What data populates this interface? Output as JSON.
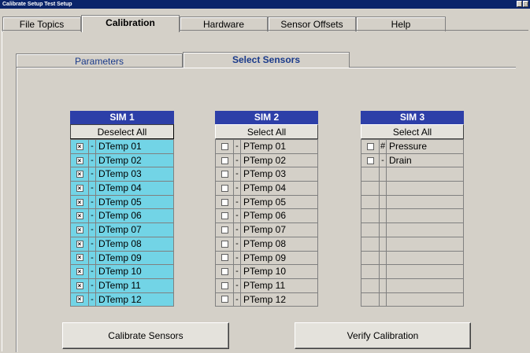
{
  "window": {
    "title": "Calibrate Setup Test Setup",
    "controls": [
      "_",
      "□"
    ]
  },
  "main_tabs": [
    {
      "label": "File Topics"
    },
    {
      "label": "Calibration"
    },
    {
      "label": "Hardware"
    },
    {
      "label": "Sensor Offsets"
    },
    {
      "label": "Help"
    }
  ],
  "sub_tabs": [
    {
      "label": "Parameters"
    },
    {
      "label": "Select Sensors"
    }
  ],
  "sims": [
    {
      "title": "SIM 1",
      "select_button": "Deselect All",
      "rows": [
        {
          "checked": true,
          "flag": "-",
          "name": "DTemp 01"
        },
        {
          "checked": true,
          "flag": "-",
          "name": "DTemp 02"
        },
        {
          "checked": true,
          "flag": "-",
          "name": "DTemp 03"
        },
        {
          "checked": true,
          "flag": "-",
          "name": "DTemp 04"
        },
        {
          "checked": true,
          "flag": "-",
          "name": "DTemp 05"
        },
        {
          "checked": true,
          "flag": "-",
          "name": "DTemp 06"
        },
        {
          "checked": true,
          "flag": "-",
          "name": "DTemp 07"
        },
        {
          "checked": true,
          "flag": "-",
          "name": "DTemp 08"
        },
        {
          "checked": true,
          "flag": "-",
          "name": "DTemp 09"
        },
        {
          "checked": true,
          "flag": "-",
          "name": "DTemp 10"
        },
        {
          "checked": true,
          "flag": "-",
          "name": "DTemp 11"
        },
        {
          "checked": true,
          "flag": "-",
          "name": "DTemp 12"
        }
      ]
    },
    {
      "title": "SIM 2",
      "select_button": "Select All",
      "rows": [
        {
          "checked": false,
          "flag": "-",
          "name": "PTemp 01"
        },
        {
          "checked": false,
          "flag": "-",
          "name": "PTemp 02"
        },
        {
          "checked": false,
          "flag": "-",
          "name": "PTemp 03"
        },
        {
          "checked": false,
          "flag": "-",
          "name": "PTemp 04"
        },
        {
          "checked": false,
          "flag": "-",
          "name": "PTemp 05"
        },
        {
          "checked": false,
          "flag": "-",
          "name": "PTemp 06"
        },
        {
          "checked": false,
          "flag": "-",
          "name": "PTemp 07"
        },
        {
          "checked": false,
          "flag": "-",
          "name": "PTemp 08"
        },
        {
          "checked": false,
          "flag": "-",
          "name": "PTemp 09"
        },
        {
          "checked": false,
          "flag": "-",
          "name": "PTemp 10"
        },
        {
          "checked": false,
          "flag": "-",
          "name": "PTemp 11"
        },
        {
          "checked": false,
          "flag": "-",
          "name": "PTemp 12"
        }
      ]
    },
    {
      "title": "SIM 3",
      "select_button": "Select All",
      "rows": [
        {
          "checked": false,
          "flag": "#",
          "name": "Pressure"
        },
        {
          "checked": false,
          "flag": "-",
          "name": "Drain"
        },
        {
          "empty": true
        },
        {
          "empty": true
        },
        {
          "empty": true
        },
        {
          "empty": true
        },
        {
          "empty": true
        },
        {
          "empty": true
        },
        {
          "empty": true
        },
        {
          "empty": true
        },
        {
          "empty": true
        },
        {
          "empty": true
        }
      ]
    }
  ],
  "actions": {
    "calibrate_label": "Calibrate Sensors",
    "verify_label": "Verify Calibration"
  },
  "colors": {
    "title_bar": "#0a246a",
    "sim_header": "#2d3fa8",
    "selected_row": "#72d4e6",
    "tab_text": "#1a3a8a"
  },
  "icons": {
    "checked": "check-mark-icon"
  }
}
